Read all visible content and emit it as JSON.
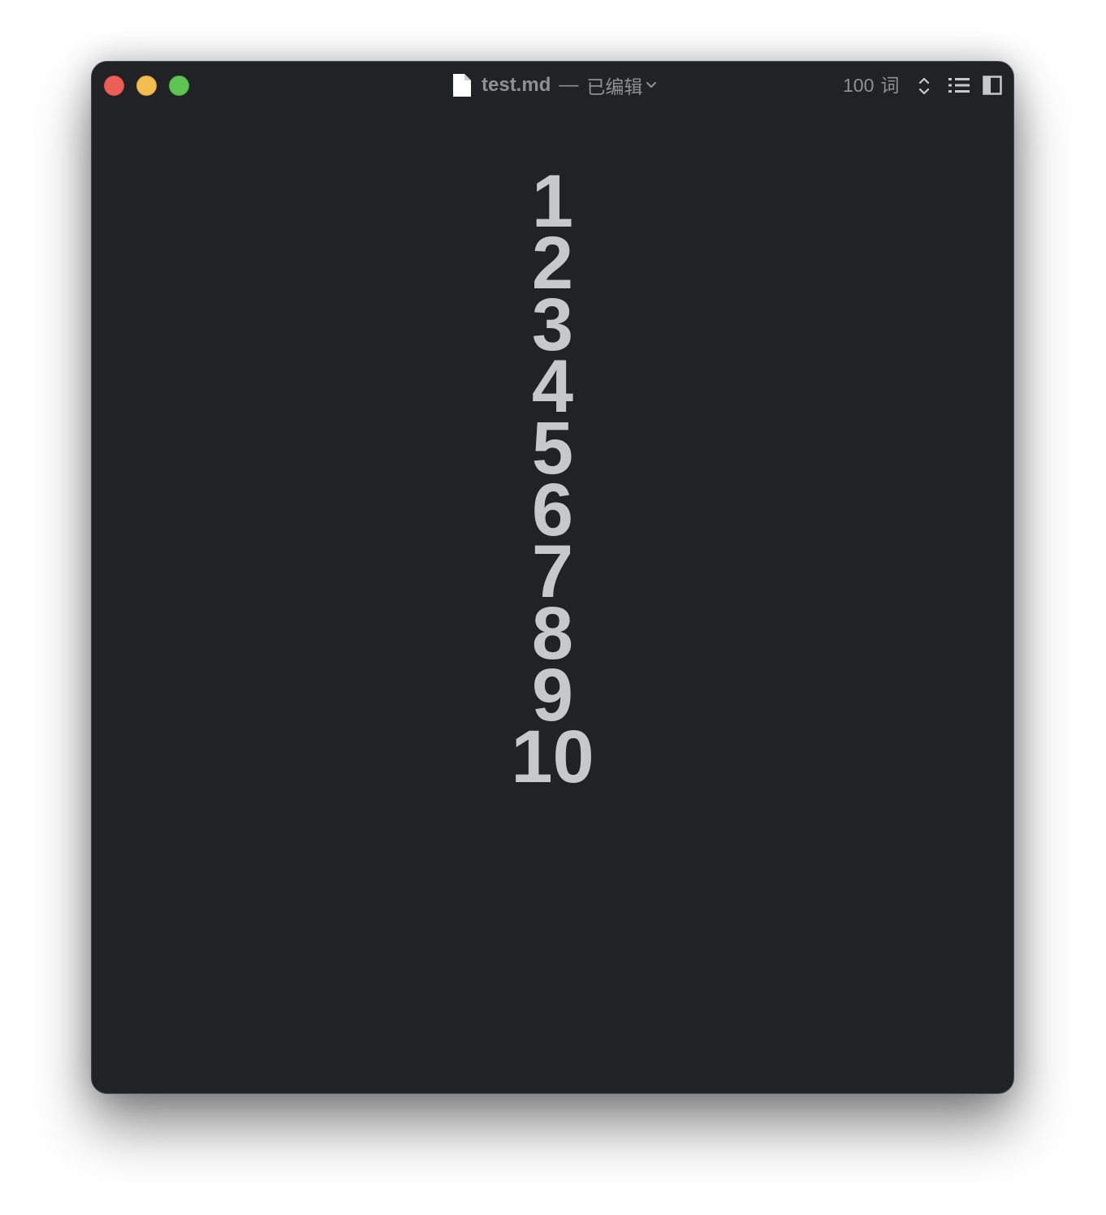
{
  "window": {
    "file_name": "test.md",
    "separator": "—",
    "status": "已编辑",
    "word_count": "100",
    "word_unit": "词"
  },
  "icons": {
    "close": "close-button",
    "minimize": "minimize-button",
    "zoom": "zoom-button",
    "document": "document-icon",
    "dropdown": "chevron-down-icon",
    "stepper": "up-down-chevron-icon",
    "outline": "list-icon",
    "sidebar": "sidebar-panel-icon"
  },
  "colors": {
    "close": "#ec5f57",
    "minimize": "#f4bd4f",
    "zoom": "#5ec454",
    "background": "#212226",
    "text": "#c7c8cc"
  },
  "document": {
    "lines": [
      "1",
      "2",
      "3",
      "4",
      "5",
      "6",
      "7",
      "8",
      "9",
      "10"
    ]
  }
}
